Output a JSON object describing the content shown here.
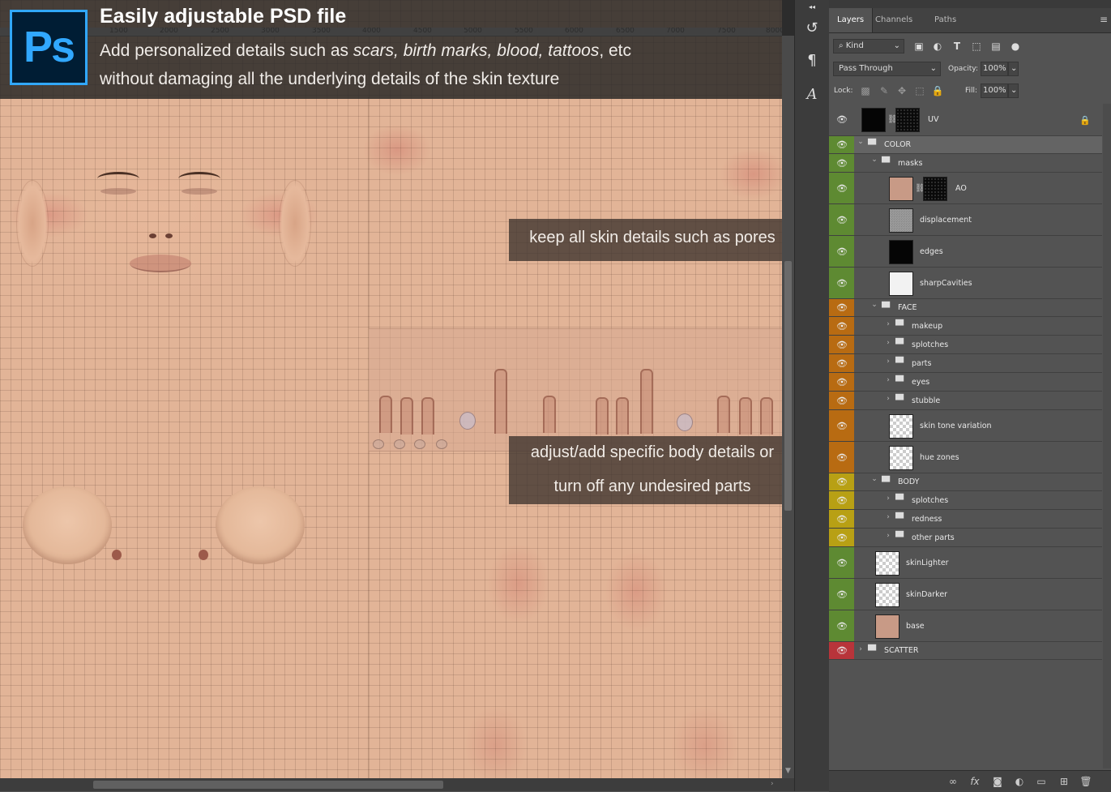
{
  "overlay": {
    "logo_text": "Ps",
    "headline": "Easily adjustable PSD file",
    "subline1_pre": "Add personalized details such as ",
    "subline1_items": "scars, birth marks, blood, tattoos",
    "subline1_post": ", etc",
    "subline2": "without damaging all the underlying details of the skin texture",
    "callout1": "keep all skin details such as pores",
    "callout2_line1": "adjust/add specific body details or",
    "callout2_line2": "turn off any undesired parts"
  },
  "ruler": [
    "1500",
    "2000",
    "2500",
    "3000",
    "3500",
    "4000",
    "4500",
    "5000",
    "5500",
    "6000",
    "6500",
    "7000",
    "7500",
    "8000"
  ],
  "tools": [
    {
      "name": "history-brush-icon",
      "glyph": "↺"
    },
    {
      "name": "paragraph-style-icon",
      "glyph": "¶"
    },
    {
      "name": "character-style-icon",
      "glyph": "A"
    }
  ],
  "panel": {
    "collapse_glyph": "◂◂",
    "tabs": [
      "Layers",
      "Channels",
      "Paths"
    ],
    "menu_glyph": "≡",
    "filter_kind": "Kind",
    "blend_mode": "Pass Through",
    "opacity_label": "Opacity:",
    "opacity_value": "100%",
    "lock_label": "Lock:",
    "fill_label": "Fill:",
    "fill_value": "100%"
  },
  "colors": {
    "green": "#5e8a32",
    "orange": "#b86b12",
    "yellow": "#b8a014",
    "red": "#b8343a"
  },
  "layers": [
    {
      "name": "UV",
      "type": "layer-mask",
      "indent": 0,
      "color": "none",
      "locked": true,
      "thumb": "black",
      "mask": "noise"
    },
    {
      "name": "COLOR",
      "type": "group-open",
      "indent": 0,
      "color": "green",
      "selected": true
    },
    {
      "name": "masks",
      "type": "group-open",
      "indent": 1,
      "color": "green"
    },
    {
      "name": "AO",
      "type": "layer-mask",
      "indent": 2,
      "color": "green",
      "thumb": "skin",
      "mask": "noise"
    },
    {
      "name": "displacement",
      "type": "layer",
      "indent": 2,
      "color": "green",
      "thumb": "grey"
    },
    {
      "name": "edges",
      "type": "layer",
      "indent": 2,
      "color": "green",
      "thumb": "black"
    },
    {
      "name": "sharpCavities",
      "type": "layer",
      "indent": 2,
      "color": "green",
      "thumb": "white"
    },
    {
      "name": "FACE",
      "type": "group-open",
      "indent": 1,
      "color": "orange"
    },
    {
      "name": "makeup",
      "type": "group-closed",
      "indent": 2,
      "color": "orange"
    },
    {
      "name": "splotches",
      "type": "group-closed",
      "indent": 2,
      "color": "orange"
    },
    {
      "name": "parts",
      "type": "group-closed",
      "indent": 2,
      "color": "orange"
    },
    {
      "name": "eyes",
      "type": "group-closed",
      "indent": 2,
      "color": "orange"
    },
    {
      "name": "stubble",
      "type": "group-closed",
      "indent": 2,
      "color": "orange"
    },
    {
      "name": "skin tone variation",
      "type": "layer",
      "indent": 2,
      "color": "orange",
      "thumb": "checker"
    },
    {
      "name": "hue zones",
      "type": "layer",
      "indent": 2,
      "color": "orange",
      "thumb": "checker"
    },
    {
      "name": "BODY",
      "type": "group-open",
      "indent": 1,
      "color": "yellow"
    },
    {
      "name": "splotches",
      "type": "group-closed",
      "indent": 2,
      "color": "yellow"
    },
    {
      "name": "redness",
      "type": "group-closed",
      "indent": 2,
      "color": "yellow"
    },
    {
      "name": "other parts",
      "type": "group-closed",
      "indent": 2,
      "color": "yellow"
    },
    {
      "name": "skinLighter",
      "type": "layer",
      "indent": 1,
      "color": "green",
      "thumb": "checker"
    },
    {
      "name": "skinDarker",
      "type": "layer",
      "indent": 1,
      "color": "green",
      "thumb": "checker"
    },
    {
      "name": "base",
      "type": "layer",
      "indent": 1,
      "color": "green",
      "thumb": "skin"
    },
    {
      "name": "SCATTER",
      "type": "group-closed",
      "indent": 0,
      "color": "red"
    }
  ],
  "bottom_icons": [
    {
      "name": "link-layers-icon",
      "glyph": "∞"
    },
    {
      "name": "fx-icon",
      "glyph": "fx"
    },
    {
      "name": "add-mask-icon",
      "glyph": "◙"
    },
    {
      "name": "adjustment-layer-icon",
      "glyph": "◐"
    },
    {
      "name": "new-group-icon",
      "glyph": "▭"
    },
    {
      "name": "new-layer-icon",
      "glyph": "⊞"
    },
    {
      "name": "delete-layer-icon",
      "glyph": "🗑"
    }
  ]
}
